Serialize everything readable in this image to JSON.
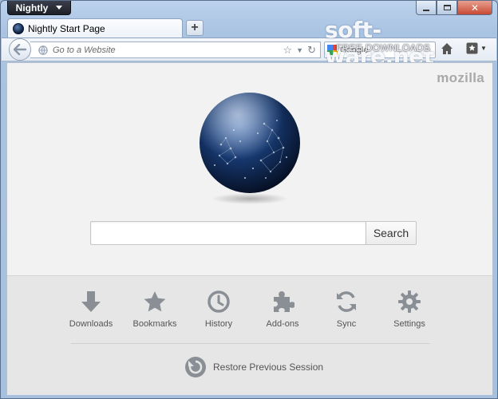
{
  "window": {
    "app_menu_label": "Nightly",
    "controls": {
      "minimize_icon": "minimize-icon",
      "maximize_icon": "maximize-icon",
      "close_icon": "close-icon"
    }
  },
  "tabs": [
    {
      "label": "Nightly Start Page",
      "icon": "nightly-favicon-icon",
      "active": true
    }
  ],
  "new_tab": {
    "label": "+"
  },
  "navbar": {
    "url_placeholder": "Go to a Website",
    "url_value": "",
    "search_engine_icon": "google-icon",
    "search_placeholder": "Google"
  },
  "watermark": {
    "main": "soft-ware.net",
    "sub": "FREE DOWNLOADS"
  },
  "content": {
    "brand": "mozilla",
    "search_button_label": "Search",
    "search_value": "",
    "launcher": [
      {
        "label": "Downloads",
        "icon": "download-arrow-icon"
      },
      {
        "label": "Bookmarks",
        "icon": "star-icon"
      },
      {
        "label": "History",
        "icon": "clock-icon"
      },
      {
        "label": "Add-ons",
        "icon": "puzzle-piece-icon"
      },
      {
        "label": "Sync",
        "icon": "sync-icon"
      },
      {
        "label": "Settings",
        "icon": "gear-icon"
      }
    ],
    "restore_label": "Restore Previous Session"
  },
  "colors": {
    "chrome_blue": "#a9c3e2",
    "content_bg": "#f2f2f2",
    "launcher_bg": "#e6e6e6",
    "icon_gray": "#8a8f96",
    "close_red": "#c74a33"
  }
}
